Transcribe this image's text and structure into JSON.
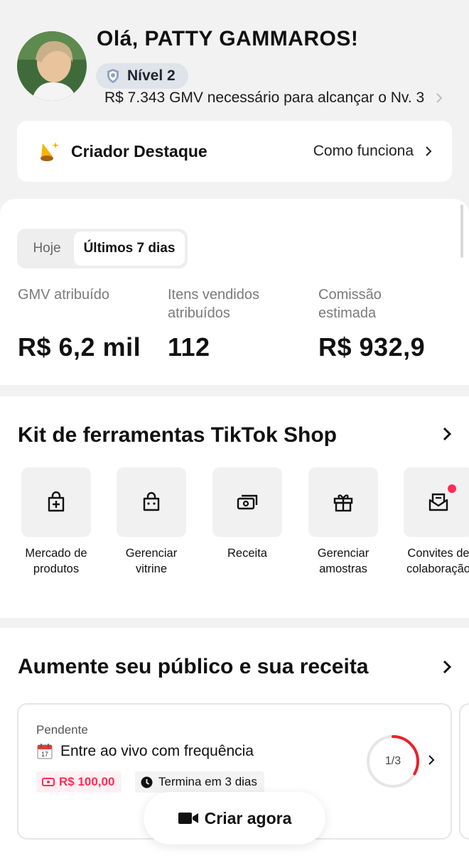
{
  "header": {
    "greeting": "Olá, PATTY GAMMAROS!",
    "level_label": "Nível 2",
    "gmv_needed": "R$ 7.343 GMV necessário para alcançar o Nv. 3"
  },
  "featured_creator": {
    "title": "Criador Destaque",
    "link": "Como funciona"
  },
  "stats": {
    "tabs": [
      "Hoje",
      "Últimos 7 dias"
    ],
    "selected_tab": "Últimos 7 dias",
    "metrics": [
      {
        "label": "GMV atribuído",
        "value": "R$ 6,2 mil"
      },
      {
        "label": "Itens vendidos atribuídos",
        "value": "112"
      },
      {
        "label": "Comissão estimada",
        "value": "R$ 932,9"
      }
    ]
  },
  "toolkit": {
    "title": "Kit de ferramentas TikTok Shop",
    "tools": [
      {
        "label": "Mercado de\nprodutos",
        "icon": "bag-plus-icon"
      },
      {
        "label": "Gerenciar\nvitrine",
        "icon": "shop-bag-icon"
      },
      {
        "label": "Receita",
        "icon": "money-icon"
      },
      {
        "label": "Gerenciar\namostras",
        "icon": "gift-icon"
      },
      {
        "label": "Convites de\ncolaboração",
        "icon": "envelope-icon",
        "notification_dot": true
      }
    ]
  },
  "audience": {
    "title": "Aumente seu público e sua receita",
    "task": {
      "status": "Pendente",
      "title": "Entre ao vivo com frequência",
      "reward": "R$ 100,00",
      "deadline": "Termina em 3 dias",
      "progress_text": "1/3",
      "progress": 0.333
    },
    "cta": "Criar agora"
  },
  "colors": {
    "accent": "#fe2c55",
    "background": "#f2f2f3",
    "level_badge": "#dfe3ea"
  }
}
